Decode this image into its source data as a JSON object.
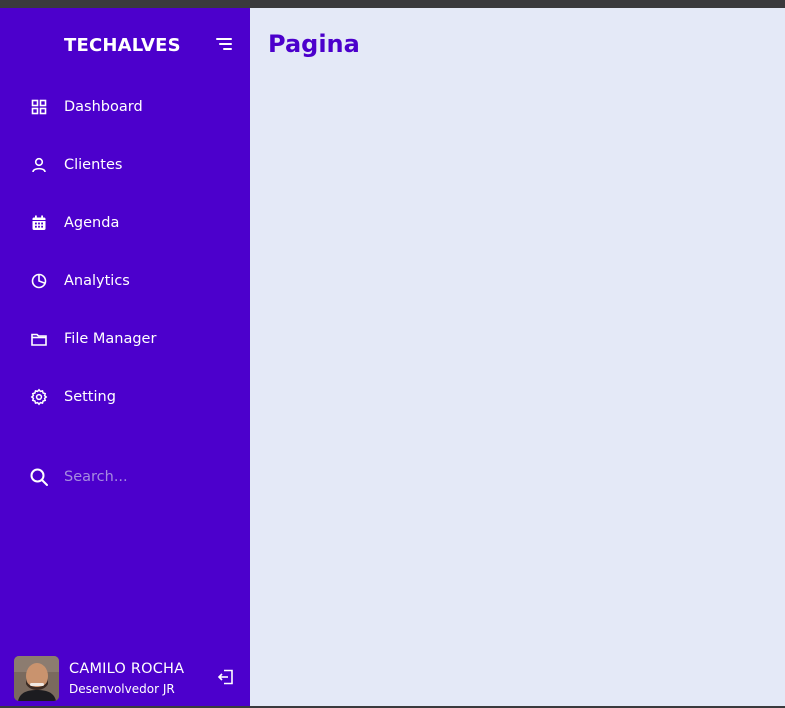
{
  "sidebar": {
    "brand": "TECHALVES",
    "toggle_icon": "menu-lines-icon",
    "items": [
      {
        "label": "Dashboard",
        "icon": "grid-icon"
      },
      {
        "label": "Clientes",
        "icon": "user-icon"
      },
      {
        "label": "Agenda",
        "icon": "calendar-icon"
      },
      {
        "label": "Analytics",
        "icon": "pie-chart-icon"
      },
      {
        "label": "File Manager",
        "icon": "folder-icon"
      },
      {
        "label": "Setting",
        "icon": "gear-icon"
      }
    ],
    "search": {
      "placeholder": "Search...",
      "value": "",
      "icon": "search-icon"
    },
    "profile": {
      "name": "CAMILO ROCHA",
      "role": "Desenvolvedor JR",
      "logout_icon": "logout-icon"
    }
  },
  "main": {
    "title": "Pagina"
  },
  "colors": {
    "sidebar_bg": "#4c00cc",
    "main_bg": "#e4e9f7",
    "accent": "#4c00cc",
    "text_light": "#ffffff"
  }
}
